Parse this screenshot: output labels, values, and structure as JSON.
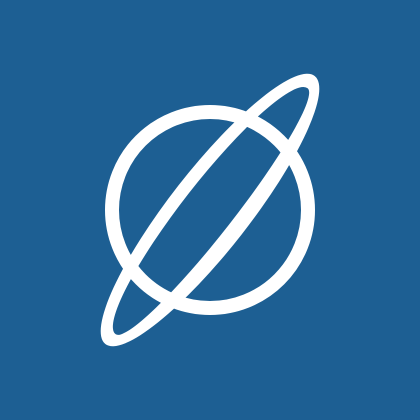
{
  "app_icon": {
    "icon_name": "planet-orbit-icon",
    "colors": {
      "background": "#1D5F93",
      "foreground": "#FFFFFF"
    }
  }
}
